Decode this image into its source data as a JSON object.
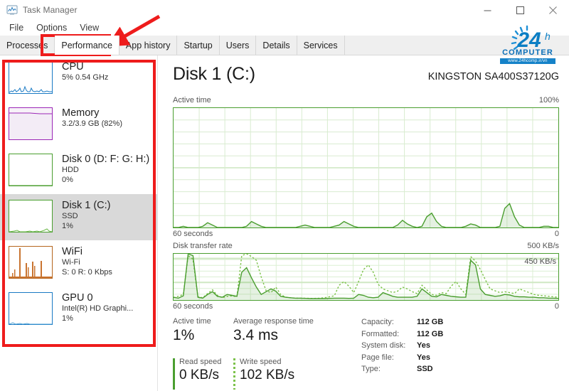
{
  "window": {
    "title": "Task Manager",
    "icon": "task-manager-icon",
    "minimize_label": "–",
    "maximize_label": "□",
    "close_label": "✕"
  },
  "menu": {
    "items": [
      {
        "label": "File"
      },
      {
        "label": "Options"
      },
      {
        "label": "View"
      }
    ]
  },
  "tabs": [
    {
      "label": "Processes",
      "active": false
    },
    {
      "label": "Performance",
      "active": true
    },
    {
      "label": "App history",
      "active": false
    },
    {
      "label": "Startup",
      "active": false
    },
    {
      "label": "Users",
      "active": false
    },
    {
      "label": "Details",
      "active": false
    },
    {
      "label": "Services",
      "active": false
    }
  ],
  "sidebar": {
    "items": [
      {
        "name": "CPU",
        "lines": [
          "5%  0.54 GHz"
        ],
        "color": "#1a7ac4",
        "selected": false
      },
      {
        "name": "Memory",
        "lines": [
          "3.2/3.9 GB (82%)"
        ],
        "color": "#9b26b6",
        "selected": false
      },
      {
        "name": "Disk 0 (D: F: G: H:)",
        "lines": [
          "HDD",
          "0%"
        ],
        "color": "#4a9e2f",
        "selected": false
      },
      {
        "name": "Disk 1 (C:)",
        "lines": [
          "SSD",
          "1%"
        ],
        "color": "#4a9e2f",
        "selected": true
      },
      {
        "name": "WiFi",
        "lines": [
          "Wi-Fi",
          "S: 0 R: 0 Kbps"
        ],
        "color": "#b5651d",
        "selected": false
      },
      {
        "name": "GPU 0",
        "lines": [
          "Intel(R) HD Graphi...",
          "1%"
        ],
        "color": "#1a7ac4",
        "selected": false
      }
    ]
  },
  "detail": {
    "title": "Disk 1 (C:)",
    "model": "KINGSTON SA400S37120G",
    "active_chart": {
      "label": "Active time",
      "max_label": "100%",
      "left_foot": "60 seconds",
      "right_foot": "0"
    },
    "transfer_chart": {
      "label": "Disk transfer rate",
      "max_label": "500 KB/s",
      "inline_label": "450 KB/s",
      "left_foot": "60 seconds",
      "right_foot": "0"
    },
    "stats": {
      "active_time_label": "Active time",
      "active_time_value": "1%",
      "response_label": "Average response time",
      "response_value": "3.4 ms",
      "read_label": "Read speed",
      "read_value": "0 KB/s",
      "write_label": "Write speed",
      "write_value": "102 KB/s"
    },
    "sysinfo": [
      {
        "key": "Capacity:",
        "value": "112 GB"
      },
      {
        "key": "Formatted:",
        "value": "112 GB"
      },
      {
        "key": "System disk:",
        "value": "Yes"
      },
      {
        "key": "Page file:",
        "value": "Yes"
      },
      {
        "key": "Type:",
        "value": "SSD"
      }
    ]
  },
  "watermark": {
    "number": "24",
    "suffix": "h",
    "brand": "COMPUTER",
    "url": "www.24hcomp.ir/vn"
  },
  "colors": {
    "disk_green": "#4a9e2f",
    "disk_green_light": "#7cc24a",
    "cpu_blue": "#1a7ac4",
    "memory_purple": "#9b26b6",
    "wifi_orange": "#b5651d",
    "annotation_red": "#ee1c1c",
    "tab_strip_bg": "#efefef",
    "selected_bg": "#d9d9d9"
  },
  "chart_data": {
    "type": "line",
    "charts": [
      {
        "id": "active-time",
        "title": "Active time",
        "ylabel": "",
        "xlabel": "60 seconds",
        "ylim": [
          0,
          100
        ],
        "xlim": [
          60,
          0
        ],
        "grid": true,
        "series": [
          {
            "name": "Active time",
            "style": "solid",
            "color": "#4a9e2f",
            "values": [
              0,
              0,
              1,
              0,
              0,
              0,
              1,
              4,
              2,
              0,
              0,
              0,
              0,
              0,
              0,
              1,
              5,
              3,
              1,
              0,
              0,
              0,
              0,
              0,
              0,
              0,
              1,
              2,
              1,
              0,
              0,
              0,
              0,
              1,
              2,
              5,
              3,
              1,
              0,
              0,
              0,
              0,
              0,
              0,
              0,
              0,
              2,
              6,
              3,
              1,
              0,
              1,
              9,
              12,
              5,
              1,
              0,
              0,
              0,
              0,
              1,
              3,
              2,
              0,
              0,
              0,
              0,
              1,
              16,
              20,
              9,
              2,
              0,
              0,
              0,
              0,
              1,
              1,
              0,
              0
            ]
          }
        ]
      },
      {
        "id": "disk-transfer-rate",
        "title": "Disk transfer rate",
        "ylabel": "KB/s",
        "xlabel": "60 seconds",
        "ylim": [
          0,
          500
        ],
        "annotation": "450 KB/s",
        "xlim": [
          60,
          0
        ],
        "grid": true,
        "series": [
          {
            "name": "Read speed",
            "style": "solid",
            "color": "#4a9e2f",
            "values": [
              30,
              20,
              45,
              500,
              480,
              30,
              20,
              60,
              90,
              40,
              30,
              60,
              50,
              40,
              300,
              350,
              240,
              140,
              60,
              90,
              120,
              95,
              40,
              30,
              25,
              20,
              20,
              18,
              15,
              15,
              15,
              15,
              18,
              20,
              20,
              20,
              18,
              20,
              60,
              50,
              30,
              25,
              30,
              80,
              60,
              40,
              30,
              30,
              30,
              30,
              40,
              120,
              80,
              40,
              35,
              60,
              50,
              40,
              35,
              30,
              30,
              430,
              380,
              120,
              60,
              50,
              40,
              45,
              60,
              55,
              40,
              35,
              35,
              30,
              30,
              25,
              25,
              20,
              20,
              18
            ]
          },
          {
            "name": "Write speed",
            "style": "dotted",
            "color": "#7cc24a",
            "values": [
              25,
              40,
              60,
              480,
              440,
              35,
              25,
              70,
              110,
              50,
              25,
              40,
              45,
              35,
              480,
              500,
              470,
              430,
              250,
              100,
              80,
              140,
              60,
              30,
              25,
              20,
              20,
              20,
              18,
              18,
              20,
              25,
              35,
              45,
              160,
              200,
              150,
              80,
              200,
              330,
              380,
              300,
              170,
              120,
              100,
              80,
              95,
              140,
              120,
              90,
              70,
              160,
              110,
              60,
              50,
              80,
              70,
              150,
              200,
              120,
              60,
              470,
              420,
              330,
              220,
              120,
              100,
              80,
              90,
              80,
              70,
              120,
              100,
              80,
              60,
              50,
              45,
              40,
              35,
              30
            ]
          }
        ]
      }
    ]
  }
}
